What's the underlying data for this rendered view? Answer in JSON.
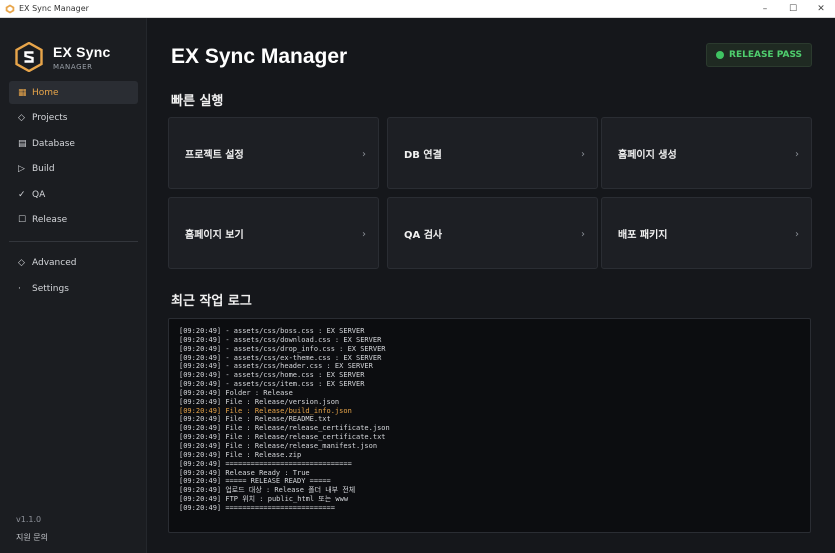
{
  "window": {
    "title": "EX Sync Manager",
    "controls": [
      "–",
      "☐",
      "✕"
    ]
  },
  "brand": {
    "name": "EX Sync",
    "subtitle": "MANAGER"
  },
  "sidebar": {
    "items": [
      {
        "label": "Home",
        "icon": "▦",
        "active": true
      },
      {
        "label": "Projects",
        "icon": "◇",
        "active": false
      },
      {
        "label": "Database",
        "icon": "▤",
        "active": false
      },
      {
        "label": "Build",
        "icon": "▷",
        "active": false
      },
      {
        "label": "QA",
        "icon": "✓",
        "active": false
      },
      {
        "label": "Release",
        "icon": "☐",
        "active": false
      }
    ],
    "secondary": [
      {
        "label": "Advanced",
        "icon": "◇"
      },
      {
        "label": "Settings",
        "icon": "·"
      }
    ],
    "version": "v1.1.0",
    "support": "지원 문의"
  },
  "header": {
    "title": "EX Sync Manager",
    "status_badge": "RELEASE PASS",
    "status_color": "#3fc462"
  },
  "quick_actions": {
    "title": "빠른 실행",
    "cards": [
      {
        "label": "프로젝트 설정"
      },
      {
        "label": "DB 연결"
      },
      {
        "label": "홈페이지 생성"
      },
      {
        "label": "홈페이지 보기"
      },
      {
        "label": "QA 검사"
      },
      {
        "label": "배포 패키지"
      }
    ],
    "chevron": "›"
  },
  "log": {
    "title": "최근 작업 로그",
    "lines": [
      "[09:20:49] - assets/css/boss.css : EX SERVER",
      "[09:20:49] - assets/css/download.css : EX SERVER",
      "[09:20:49] - assets/css/drop_info.css : EX SERVER",
      "[09:20:49] - assets/css/ex-theme.css : EX SERVER",
      "[09:20:49] - assets/css/header.css : EX SERVER",
      "[09:20:49] - assets/css/home.css : EX SERVER",
      "[09:20:49] - assets/css/item.css : EX SERVER",
      "[09:20:49] Folder : Release",
      "[09:20:49] File : Release/version.json",
      "[09:20:49] File : Release/build_info.json",
      "[09:20:49] File : Release/README.txt",
      "[09:20:49] File : Release/release_certificate.json",
      "[09:20:49] File : Release/release_certificate.txt",
      "[09:20:49] File : Release/release_manifest.json",
      "[09:20:49] File : Release.zip",
      "[09:20:49] ==============================",
      "[09:20:49] Release Ready : True",
      "[09:20:49] ===== RELEASE READY =====",
      "[09:20:49] 업로드 대상 : Release 폴더 내부 전체",
      "[09:20:49] FTP 위치 : public_html 또는 www",
      "[09:20:49] =========================="
    ],
    "highlight_index": 9,
    "highlight_color": "#e8a54a"
  }
}
